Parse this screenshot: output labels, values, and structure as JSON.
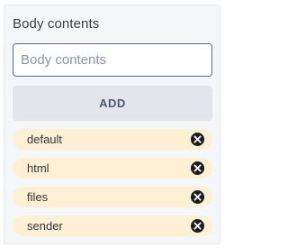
{
  "body_contents": {
    "title": "Body contents",
    "input_placeholder": "Body contents",
    "input_value": "",
    "add_label": "ADD"
  },
  "tags": [
    {
      "label": "default",
      "remove_icon": "close-circle-icon"
    },
    {
      "label": "html",
      "remove_icon": "close-circle-icon"
    },
    {
      "label": "files",
      "remove_icon": "close-circle-icon"
    },
    {
      "label": "sender",
      "remove_icon": "close-circle-icon"
    }
  ],
  "colors": {
    "panel_bg": "#f5f6f8",
    "input_border": "#5d6a9a",
    "button_bg": "#e3e5ea",
    "button_text": "#4f5872",
    "tag_bg": "#fdf0d4",
    "remove_icon_bg": "#1c1c1c"
  }
}
